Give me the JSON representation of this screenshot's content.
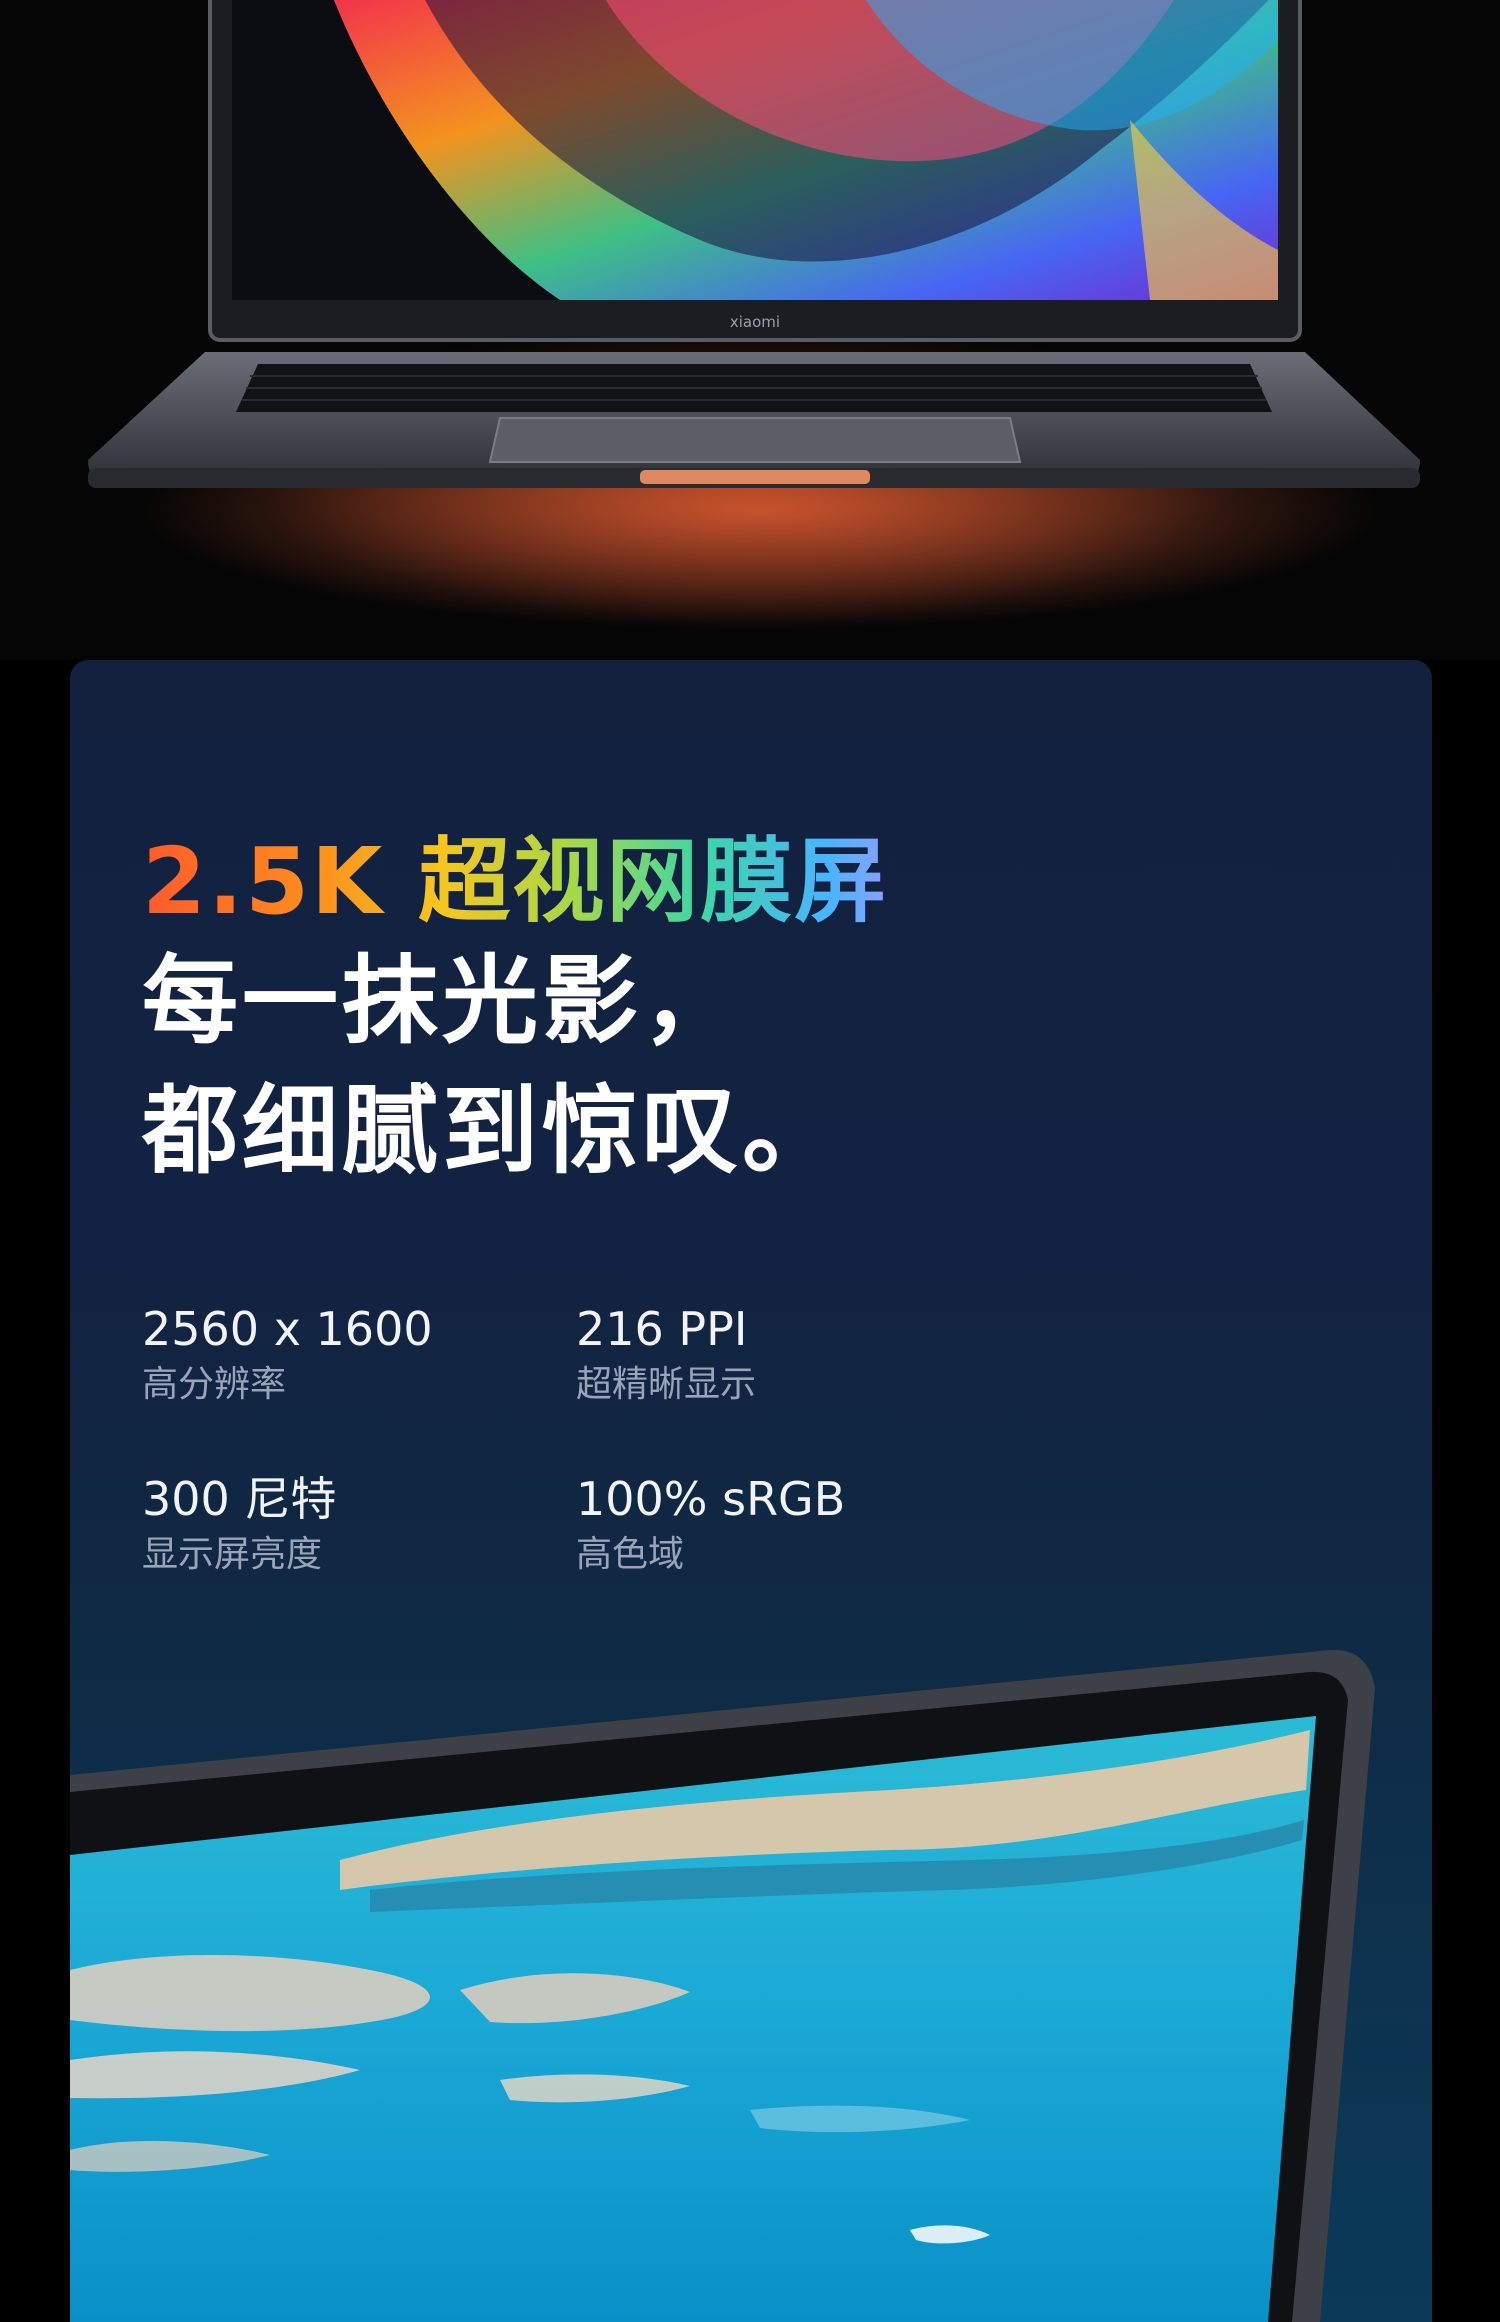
{
  "hero": {
    "brand_text": "xiaomi"
  },
  "display": {
    "title_highlight": "2.5K 超视网膜屏",
    "title_line1": "每一抹光影，",
    "title_line2": "都细腻到惊叹。",
    "specs": [
      {
        "value": "2560 x 1600",
        "label": "高分辨率"
      },
      {
        "value": "216 PPI",
        "label": "超精晰显示"
      },
      {
        "value": "300 尼特",
        "label": "显示屏亮度"
      },
      {
        "value": "100% sRGB",
        "label": "高色域"
      }
    ]
  }
}
